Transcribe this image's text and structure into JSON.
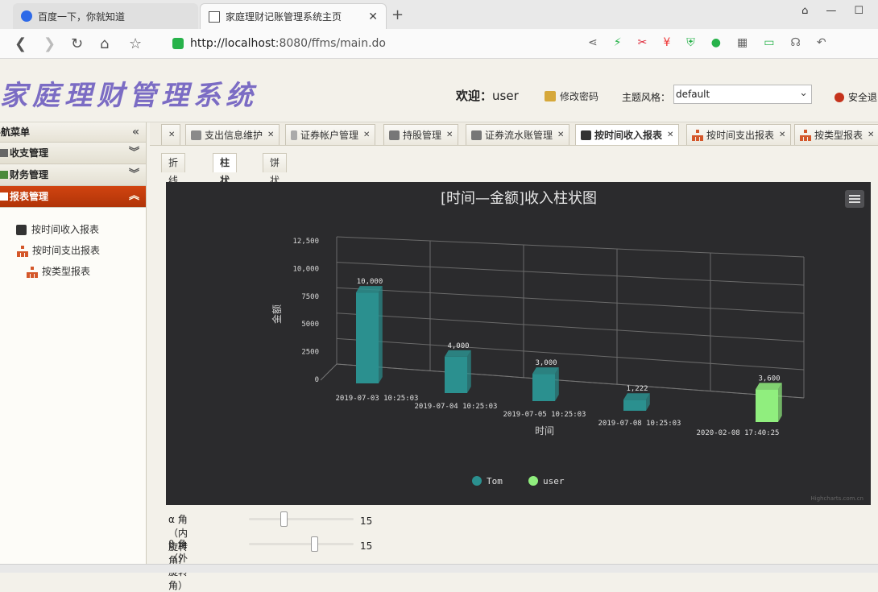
{
  "browser": {
    "tabs": [
      {
        "title": "百度一下，你就知道",
        "active": false
      },
      {
        "title": "家庭理财记账管理系统主页",
        "active": true
      }
    ],
    "url_host": "http://localhost",
    "url_rest": ":8080/ffms/main.do"
  },
  "header": {
    "logo": "家庭理财管理系统",
    "welcome_label": "欢迎：",
    "username": "user",
    "change_password": "修改密码",
    "theme_label": "主题风格：",
    "theme_value": "default",
    "logout": "安全退"
  },
  "sidebar": {
    "title": "导航菜单",
    "groups": [
      {
        "label": "收支管理",
        "active": false
      },
      {
        "label": "财务管理",
        "active": false
      },
      {
        "label": "报表管理",
        "active": true
      }
    ],
    "items": [
      {
        "label": "按时间收入报表"
      },
      {
        "label": "按时间支出报表"
      },
      {
        "label": "按类型报表"
      }
    ]
  },
  "content_tabs": [
    {
      "label": "支出信息维护"
    },
    {
      "label": "证券帐户管理"
    },
    {
      "label": "持股管理"
    },
    {
      "label": "证券流水账管理"
    },
    {
      "label": "按时间收入报表",
      "active": true
    },
    {
      "label": "按时间支出报表"
    },
    {
      "label": "按类型报表"
    }
  ],
  "chart_tabs": [
    {
      "label": "折线图"
    },
    {
      "label": "柱状图",
      "active": true
    },
    {
      "label": "饼状图"
    }
  ],
  "chart_data": {
    "type": "bar",
    "title": "[时间—金额]收入柱状图",
    "xlabel": "时间",
    "ylabel": "金额",
    "ylim": [
      0,
      12500
    ],
    "yticks": [
      "0",
      "2500",
      "5000",
      "7500",
      "10,000",
      "12,500"
    ],
    "categories": [
      "2019-07-03 10:25:03",
      "2019-07-04 10:25:03",
      "2019-07-05 10:25:03",
      "2019-07-08 10:25:03",
      "2020-02-08 17:40:25"
    ],
    "series": [
      {
        "name": "Tom",
        "color": "#2b908f",
        "values": [
          10000,
          4000,
          3000,
          1222,
          null
        ]
      },
      {
        "name": "user",
        "color": "#90ee7e",
        "values": [
          null,
          null,
          null,
          null,
          3600
        ]
      }
    ],
    "data_labels": [
      "10,000",
      "4,000",
      "3,000",
      "1,222",
      "3,600"
    ],
    "legend_position": "bottom",
    "credits": "Highcharts.com.cn",
    "options3d": true
  },
  "sliders": [
    {
      "label": "α 角（内旋转角）",
      "value": "15",
      "fraction": 0.33
    },
    {
      "label": "β 角（外旋转角）",
      "value": "15",
      "fraction": 0.62
    }
  ]
}
